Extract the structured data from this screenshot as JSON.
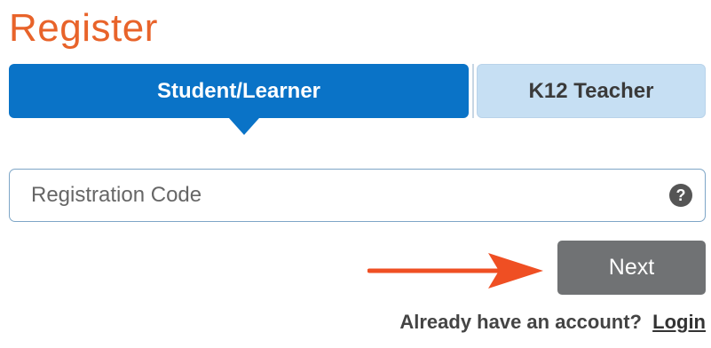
{
  "header": {
    "title": "Register"
  },
  "tabs": [
    {
      "label": "Student/Learner",
      "active": true
    },
    {
      "label": "K12 Teacher",
      "active": false
    }
  ],
  "registration": {
    "placeholder": "Registration Code",
    "value": "",
    "help_icon": "question-circle-icon"
  },
  "actions": {
    "next_label": "Next",
    "annotation_icon": "arrow-right-icon"
  },
  "footer": {
    "prompt": "Already have an account?",
    "login_label": "Login"
  },
  "colors": {
    "title": "#e8632a",
    "tab_active_bg": "#0a73c7",
    "tab_inactive_bg": "#c6dff3",
    "button_bg": "#707274",
    "help_icon_bg": "#555555",
    "arrow": "#ef4f23"
  }
}
